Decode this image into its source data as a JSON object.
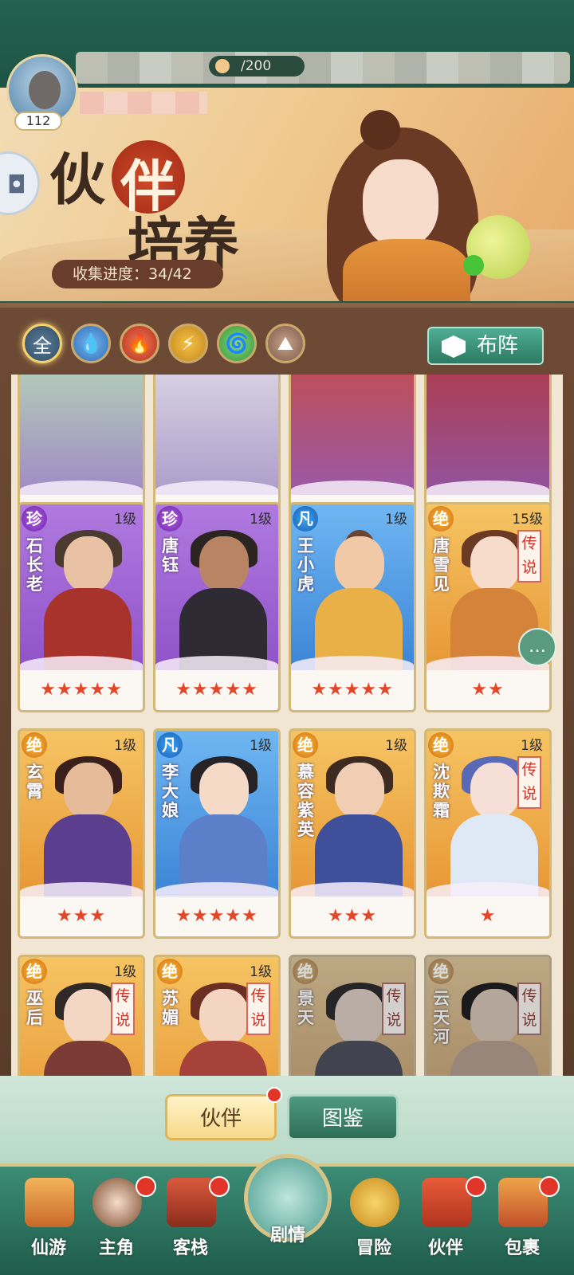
{
  "player": {
    "level": "112",
    "resource": "/200"
  },
  "banner": {
    "title_part1": "伙",
    "title_part2": "伴",
    "title_line2": "培养",
    "progress_label": "收集进度：",
    "progress_value": "34/42",
    "progress_fraction": 0.81
  },
  "filters": [
    {
      "label": "全",
      "element": "all",
      "active": true
    },
    {
      "label": "",
      "element": "water"
    },
    {
      "label": "",
      "element": "fire"
    },
    {
      "label": "",
      "element": "thunder"
    },
    {
      "label": "",
      "element": "wind"
    },
    {
      "label": "",
      "element": "earth"
    }
  ],
  "formation_button": "布阵",
  "top_row_stars": [
    "★★★★★",
    "★★★★★",
    "★★★★★",
    "★★★★★"
  ],
  "cards": [
    {
      "grade": "珍",
      "level": "1级",
      "name": "石长老",
      "stars": "★★★★★",
      "legend": ""
    },
    {
      "grade": "珍",
      "level": "1级",
      "name": "唐钰",
      "stars": "★★★★★",
      "legend": ""
    },
    {
      "grade": "凡",
      "level": "1级",
      "name": "王小虎",
      "stars": "★★★★★",
      "legend": ""
    },
    {
      "grade": "绝",
      "level": "15级",
      "name": "唐雪见",
      "stars": "★★",
      "legend": "传说"
    },
    {
      "grade": "绝",
      "level": "1级",
      "name": "玄霄",
      "stars": "★★★",
      "legend": ""
    },
    {
      "grade": "凡",
      "level": "1级",
      "name": "李大娘",
      "stars": "★★★★★",
      "legend": ""
    },
    {
      "grade": "绝",
      "level": "1级",
      "name": "慕容紫英",
      "stars": "★★★",
      "legend": ""
    },
    {
      "grade": "绝",
      "level": "1级",
      "name": "沈欺霜",
      "stars": "★",
      "legend": "传说"
    },
    {
      "grade": "绝",
      "level": "1级",
      "name": "巫后",
      "stars": "",
      "legend": "传说"
    },
    {
      "grade": "绝",
      "level": "1级",
      "name": "苏媚",
      "stars": "",
      "legend": "传说"
    },
    {
      "grade": "绝",
      "level": "",
      "name": "景天",
      "stars": "",
      "legend": "传说"
    },
    {
      "grade": "绝",
      "level": "",
      "name": "云天河",
      "stars": "",
      "legend": "传说"
    }
  ],
  "tabs": {
    "partner": "伙伴",
    "atlas": "图鉴"
  },
  "nav": {
    "xianyou": "仙游",
    "zhujue": "主角",
    "kezhan": "客栈",
    "juqing": "剧情",
    "maoxian": "冒险",
    "huoban": "伙伴",
    "baoguo": "包裹"
  }
}
